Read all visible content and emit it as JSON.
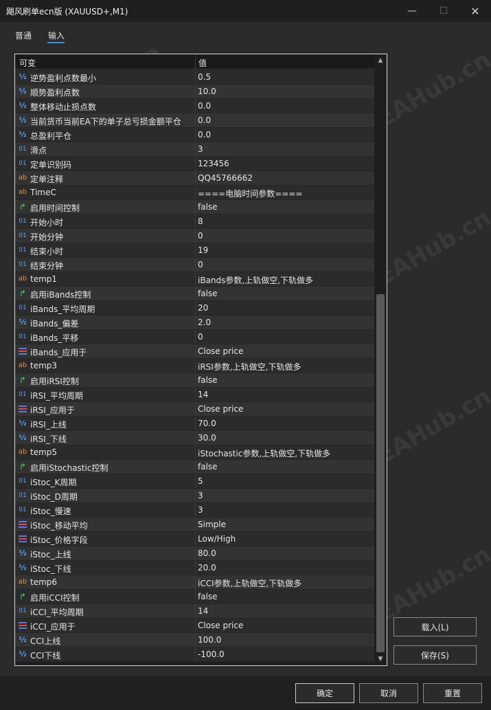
{
  "window": {
    "title": "飓风刷单ecn版 (XAUUSD+,M1)",
    "minimize_glyph": "—",
    "maximize_glyph": "☐",
    "close_glyph": "✕"
  },
  "tabs": [
    {
      "label": "普通",
      "active": false
    },
    {
      "label": "输入",
      "active": true
    }
  ],
  "table": {
    "header": {
      "name": "可变",
      "value": "值"
    },
    "rows": [
      {
        "icon": "half-icon",
        "glyph": "½",
        "name": "逆势盈利点数最小",
        "value": "0.5"
      },
      {
        "icon": "half-icon",
        "glyph": "½",
        "name": "顺势盈利点数",
        "value": "10.0"
      },
      {
        "icon": "half-icon",
        "glyph": "½",
        "name": "整体移动止损点数",
        "value": "0.0"
      },
      {
        "icon": "half-icon",
        "glyph": "½",
        "name": "当前货币当前EA下的单子总亏损金额平仓",
        "value": "0.0"
      },
      {
        "icon": "half-icon",
        "glyph": "½",
        "name": "总盈利平仓",
        "value": "0.0"
      },
      {
        "icon": "integer-icon",
        "glyph": "01",
        "name": "滑点",
        "value": "3"
      },
      {
        "icon": "integer-icon",
        "glyph": "01",
        "name": "定单识别码",
        "value": "123456"
      },
      {
        "icon": "string-icon",
        "glyph": "ab",
        "name": "定单注释",
        "value": "QQ45766662"
      },
      {
        "icon": "string-icon",
        "glyph": "ab",
        "name": "TimeC",
        "value": "====电脑时间参数===="
      },
      {
        "icon": "bool-icon",
        "glyph": "↱",
        "name": "启用时间控制",
        "value": "false"
      },
      {
        "icon": "integer-icon",
        "glyph": "01",
        "name": "开始小时",
        "value": "8"
      },
      {
        "icon": "integer-icon",
        "glyph": "01",
        "name": "开始分钟",
        "value": "0"
      },
      {
        "icon": "integer-icon",
        "glyph": "01",
        "name": "结束小时",
        "value": "19"
      },
      {
        "icon": "integer-icon",
        "glyph": "01",
        "name": "结束分钟",
        "value": "0"
      },
      {
        "icon": "string-icon",
        "glyph": "ab",
        "name": "temp1",
        "value": "iBands参数,上轨做空,下轨做多"
      },
      {
        "icon": "bool-icon",
        "glyph": "↱",
        "name": "启用iBands控制",
        "value": "false"
      },
      {
        "icon": "integer-icon",
        "glyph": "01",
        "name": "iBands_平均周期",
        "value": "20"
      },
      {
        "icon": "half-icon",
        "glyph": "½",
        "name": "iBands_偏差",
        "value": "2.0"
      },
      {
        "icon": "integer-icon",
        "glyph": "01",
        "name": "iBands_平移",
        "value": "0"
      },
      {
        "icon": "enum-icon",
        "glyph": "",
        "name": "iBands_应用于",
        "value": "Close price"
      },
      {
        "icon": "string-icon",
        "glyph": "ab",
        "name": "temp3",
        "value": "iRSI参数,上轨做空,下轨做多"
      },
      {
        "icon": "bool-icon",
        "glyph": "↱",
        "name": "启用iRSI控制",
        "value": "false"
      },
      {
        "icon": "integer-icon",
        "glyph": "01",
        "name": "iRSI_平均周期",
        "value": "14"
      },
      {
        "icon": "enum-icon",
        "glyph": "",
        "name": "iRSI_应用于",
        "value": "Close price"
      },
      {
        "icon": "half-icon",
        "glyph": "½",
        "name": "iRSI_上线",
        "value": "70.0"
      },
      {
        "icon": "half-icon",
        "glyph": "½",
        "name": "iRSI_下线",
        "value": "30.0"
      },
      {
        "icon": "string-icon",
        "glyph": "ab",
        "name": "temp5",
        "value": "iStochastic参数,上轨做空,下轨做多"
      },
      {
        "icon": "bool-icon",
        "glyph": "↱",
        "name": "启用iStochastic控制",
        "value": "false"
      },
      {
        "icon": "integer-icon",
        "glyph": "01",
        "name": "iStoc_K周期",
        "value": "5"
      },
      {
        "icon": "integer-icon",
        "glyph": "01",
        "name": "iStoc_D周期",
        "value": "3"
      },
      {
        "icon": "integer-icon",
        "glyph": "01",
        "name": "iStoc_慢速",
        "value": "3"
      },
      {
        "icon": "enum-icon",
        "glyph": "",
        "name": "iStoc_移动平均",
        "value": "Simple"
      },
      {
        "icon": "enum-icon",
        "glyph": "",
        "name": "iStoc_价格字段",
        "value": "Low/High"
      },
      {
        "icon": "half-icon",
        "glyph": "½",
        "name": "iStoc_上线",
        "value": "80.0"
      },
      {
        "icon": "half-icon",
        "glyph": "½",
        "name": "iStoc_下线",
        "value": "20.0"
      },
      {
        "icon": "string-icon",
        "glyph": "ab",
        "name": "temp6",
        "value": "iCCI参数,上轨做空,下轨做多"
      },
      {
        "icon": "bool-icon",
        "glyph": "↱",
        "name": "启用iCCI控制",
        "value": "false"
      },
      {
        "icon": "integer-icon",
        "glyph": "01",
        "name": "iCCI_平均周期",
        "value": "14"
      },
      {
        "icon": "enum-icon",
        "glyph": "",
        "name": "iCCI_应用于",
        "value": "Close price"
      },
      {
        "icon": "half-icon",
        "glyph": "½",
        "name": "CCI上线",
        "value": "100.0"
      },
      {
        "icon": "half-icon",
        "glyph": "½",
        "name": "CCI下线",
        "value": "-100.0"
      }
    ]
  },
  "side_buttons": {
    "load": "载入(L)",
    "save": "保存(S)"
  },
  "footer_buttons": {
    "ok": "确定",
    "cancel": "取消",
    "reset": "重置"
  },
  "watermark": "EAHub.cn",
  "colors": {
    "background": "#2b2b2b",
    "row_odd": "#2b2b2b",
    "row_even": "#333333",
    "half_icon": "#5aa0ff",
    "integer_icon": "#5aa0ff",
    "string_icon": "#e0904a",
    "bool_icon": "#3ccf6a",
    "tab_accent": "#3a8ee6"
  }
}
